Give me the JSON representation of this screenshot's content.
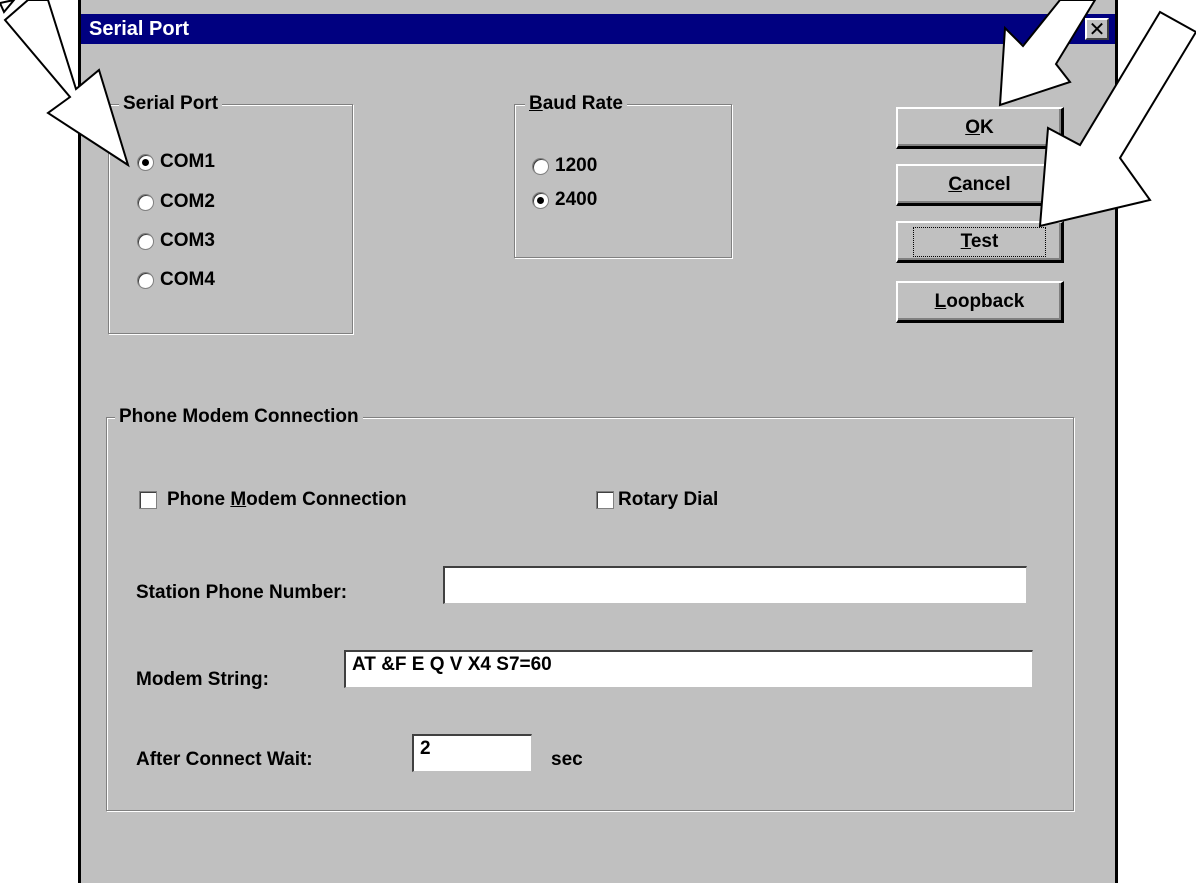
{
  "dialog": {
    "title": "Serial Port",
    "close_symbol": "✕"
  },
  "serial_port_group": {
    "label": "Serial Port",
    "options": [
      {
        "label": "COM1",
        "selected": true
      },
      {
        "label": "COM2",
        "selected": false
      },
      {
        "label": "COM3",
        "selected": false
      },
      {
        "label": "COM4",
        "selected": false
      }
    ]
  },
  "baud_rate_group": {
    "label_hotkey": "B",
    "label_rest": "aud Rate",
    "options": [
      {
        "label": "1200",
        "selected": false
      },
      {
        "label": "2400",
        "selected": true
      }
    ]
  },
  "buttons": {
    "ok": {
      "hotkey": "O",
      "rest": "K"
    },
    "cancel": {
      "hotkey": "C",
      "rest": "ancel"
    },
    "test": {
      "hotkey": "T",
      "rest": "est"
    },
    "loopback": {
      "hotkey": "L",
      "rest": "oopback"
    }
  },
  "modem_group": {
    "label": "Phone Modem Connection",
    "phone_modem_checkbox": {
      "pre": "Phone ",
      "hotkey": "M",
      "post": "odem Connection",
      "checked": false
    },
    "rotary_dial_checkbox": {
      "label": "Rotary Dial",
      "checked": false
    },
    "station_phone": {
      "label": "Station Phone Number:",
      "value": ""
    },
    "modem_string": {
      "label": "Modem String:",
      "value": "AT &F E Q V X4 S7=60"
    },
    "after_connect": {
      "label": "After Connect Wait:",
      "value": "2",
      "unit": "sec"
    }
  },
  "colors": {
    "title_bar": "#000080",
    "dialog_face": "#c0c0c0",
    "annotation_arrow_fill": "#ffffff",
    "annotation_arrow_stroke": "#000000"
  }
}
